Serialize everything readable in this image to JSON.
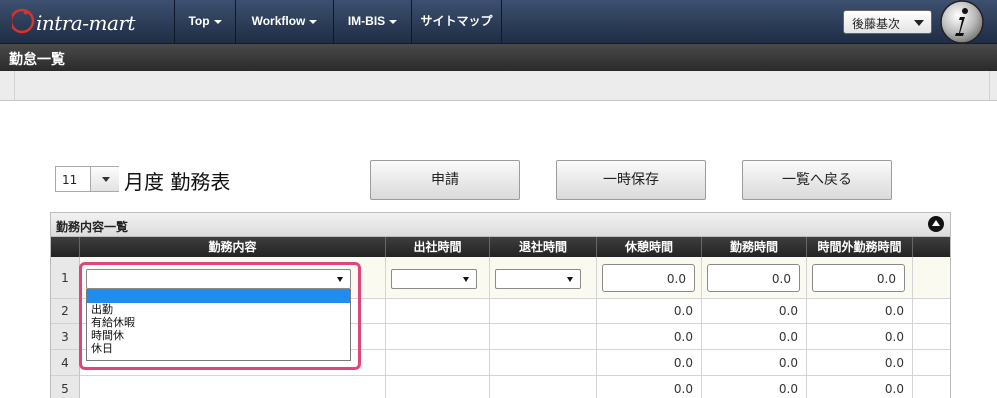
{
  "brand": {
    "logo_text": "intra-mart"
  },
  "nav": {
    "items": [
      {
        "label": "Top",
        "has_caret": true
      },
      {
        "label": "Workflow",
        "has_caret": true
      },
      {
        "label": "IM-BIS",
        "has_caret": true
      },
      {
        "label": "サイトマップ",
        "has_caret": false
      }
    ],
    "user_name": "後藤基次"
  },
  "page": {
    "title": "勤怠一覧"
  },
  "month_selector": {
    "value": "11",
    "suffix": "月度 勤務表"
  },
  "actions": {
    "apply": "申請",
    "save_temp": "一時保存",
    "back": "一覧へ戻る"
  },
  "section": {
    "title": "勤務内容一覧"
  },
  "table": {
    "columns": [
      "勤務内容",
      "出社時間",
      "退社時間",
      "休憩時間",
      "勤務時間",
      "時間外勤務時間"
    ],
    "rows": [
      {
        "no": "1",
        "break": "0.0",
        "work": "0.0",
        "overtime": "0.0"
      },
      {
        "no": "2",
        "break": "0.0",
        "work": "0.0",
        "overtime": "0.0"
      },
      {
        "no": "3",
        "break": "0.0",
        "work": "0.0",
        "overtime": "0.0"
      },
      {
        "no": "4",
        "break": "0.0",
        "work": "0.0",
        "overtime": "0.0"
      },
      {
        "no": "5",
        "break": "0.0",
        "work": "0.0",
        "overtime": "0.0"
      }
    ]
  },
  "dropdown": {
    "options": [
      "",
      "出勤",
      "有給休暇",
      "時間休",
      "休日"
    ]
  },
  "colors": {
    "accent_highlight": "#e0457b",
    "selected_option": "#1e8cf0",
    "nav_bg": "#2a3a58"
  }
}
